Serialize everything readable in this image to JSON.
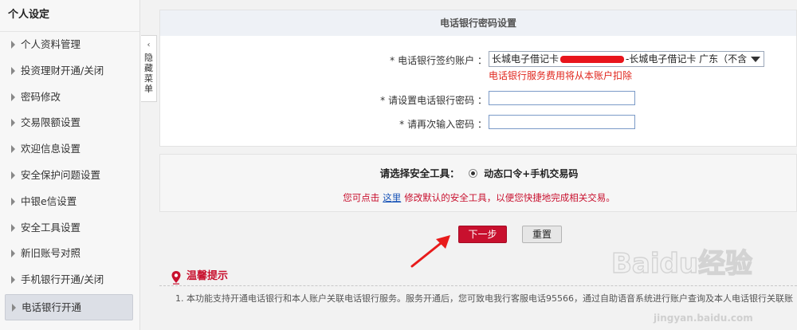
{
  "sidebar": {
    "title": "个人设定",
    "items": [
      {
        "label": "个人资料管理"
      },
      {
        "label": "投资理财开通/关闭"
      },
      {
        "label": "密码修改"
      },
      {
        "label": "交易限额设置"
      },
      {
        "label": "欢迎信息设置"
      },
      {
        "label": "安全保护问题设置"
      },
      {
        "label": "中银e信设置"
      },
      {
        "label": "安全工具设置"
      },
      {
        "label": "新旧账号对照"
      },
      {
        "label": "手机银行开通/关闭"
      },
      {
        "label": "电话银行开通",
        "active": true
      }
    ]
  },
  "collapse": {
    "label": "隐藏菜单",
    "arrow": "‹"
  },
  "form": {
    "header": "电话银行密码设置",
    "account_label": "电话银行签约账户 ：",
    "account_value_prefix": "长城电子借记卡",
    "account_value_suffix": "-长城电子借记卡 广东（不含…",
    "fee_hint": "电话银行服务费用将从本账户扣除",
    "password_label": "请设置电话银行密码 ：",
    "confirm_label": "请再次输入密码 ：",
    "required_mark": "*"
  },
  "security": {
    "label": "请选择安全工具：",
    "option": "动态口令+手机交易码",
    "note_prefix": "您可点击",
    "note_link": "这里",
    "note_suffix": "修改默认的安全工具，以便您快捷地完成相关交易。"
  },
  "buttons": {
    "next": "下一步",
    "reset": "重置"
  },
  "tips": {
    "title": "温馨提示",
    "line1": "1. 本功能支持开通电话银行和本人账户关联电话银行服务。服务开通后，您可致电我行客服电话95566，通过自助语音系统进行账户查询及本人电话银行关联账"
  },
  "watermark": {
    "brand": "Baidu经验",
    "url": "jingyan.baidu.com"
  },
  "colors": {
    "brand_red": "#c8102e",
    "link_blue": "#1a55b8",
    "hint_red": "#e0261d"
  }
}
